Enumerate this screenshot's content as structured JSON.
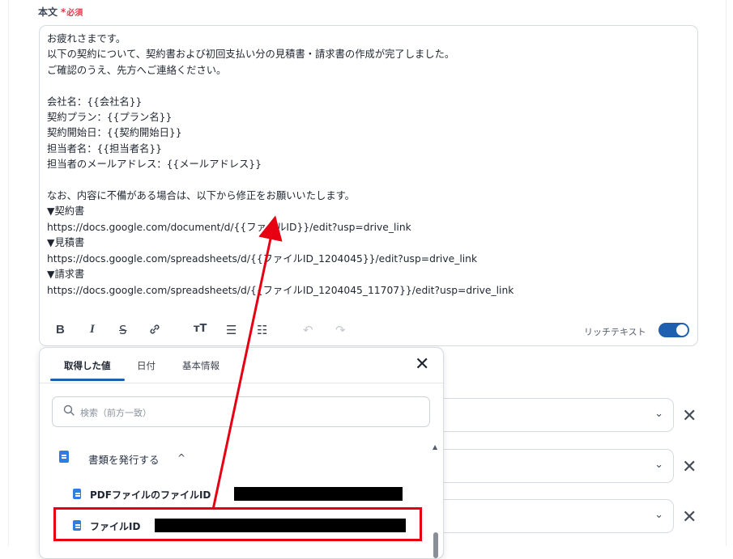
{
  "field": {
    "label": "本文",
    "required_star": "*",
    "required_text": "必須"
  },
  "editor": {
    "lines": [
      "お疲れさまです。",
      "以下の契約について、契約書および初回支払い分の見積書・請求書の作成が完了しました。",
      "ご確認のうえ、先方へご連絡ください。",
      "",
      "会社名：{{会社名}}",
      "契約プラン：{{プラン名}}",
      "契約開始日：{{契約開始日}}",
      "担当者名：{{担当者名}}",
      "担当者のメールアドレス：{{メールアドレス}}",
      "",
      "なお、内容に不備がある場合は、以下から修正をお願いいたします。",
      "▼契約書",
      "https://docs.google.com/document/d/{{ファイルID}}/edit?usp=drive_link",
      "▼見積書",
      "https://docs.google.com/spreadsheets/d/{{ファイルID_1204045}}/edit?usp=drive_link",
      "▼請求書",
      "https://docs.google.com/spreadsheets/d/{{ファイルID_1204045_11707}}/edit?usp=drive_link"
    ]
  },
  "toolbar": {
    "bold": "B",
    "italic": "I",
    "strike": "S",
    "link_icon": "link-icon",
    "heading": "ᴛT",
    "bullet_list": "☰",
    "ordered_list": "☷",
    "undo": "↶",
    "redo": "↷",
    "rich_text_label": "リッチテキスト",
    "rich_text_enabled": true
  },
  "popup": {
    "tabs": [
      "取得した値",
      "日付",
      "基本情報"
    ],
    "active_tab": 0,
    "close": "✕",
    "search_placeholder": "検索（前方一致）",
    "group": {
      "title": "書類を発行する",
      "caret": "^"
    },
    "items": [
      {
        "label": "PDFファイルのファイルID"
      },
      {
        "label": "ファイルID"
      }
    ]
  },
  "rows": {
    "chevron": "⌄",
    "remove": "✕"
  },
  "colors": {
    "accent": "#1f5fb0",
    "highlight": "#e60012",
    "required": "#e7384a",
    "doc_icon": "#2f7de1"
  }
}
